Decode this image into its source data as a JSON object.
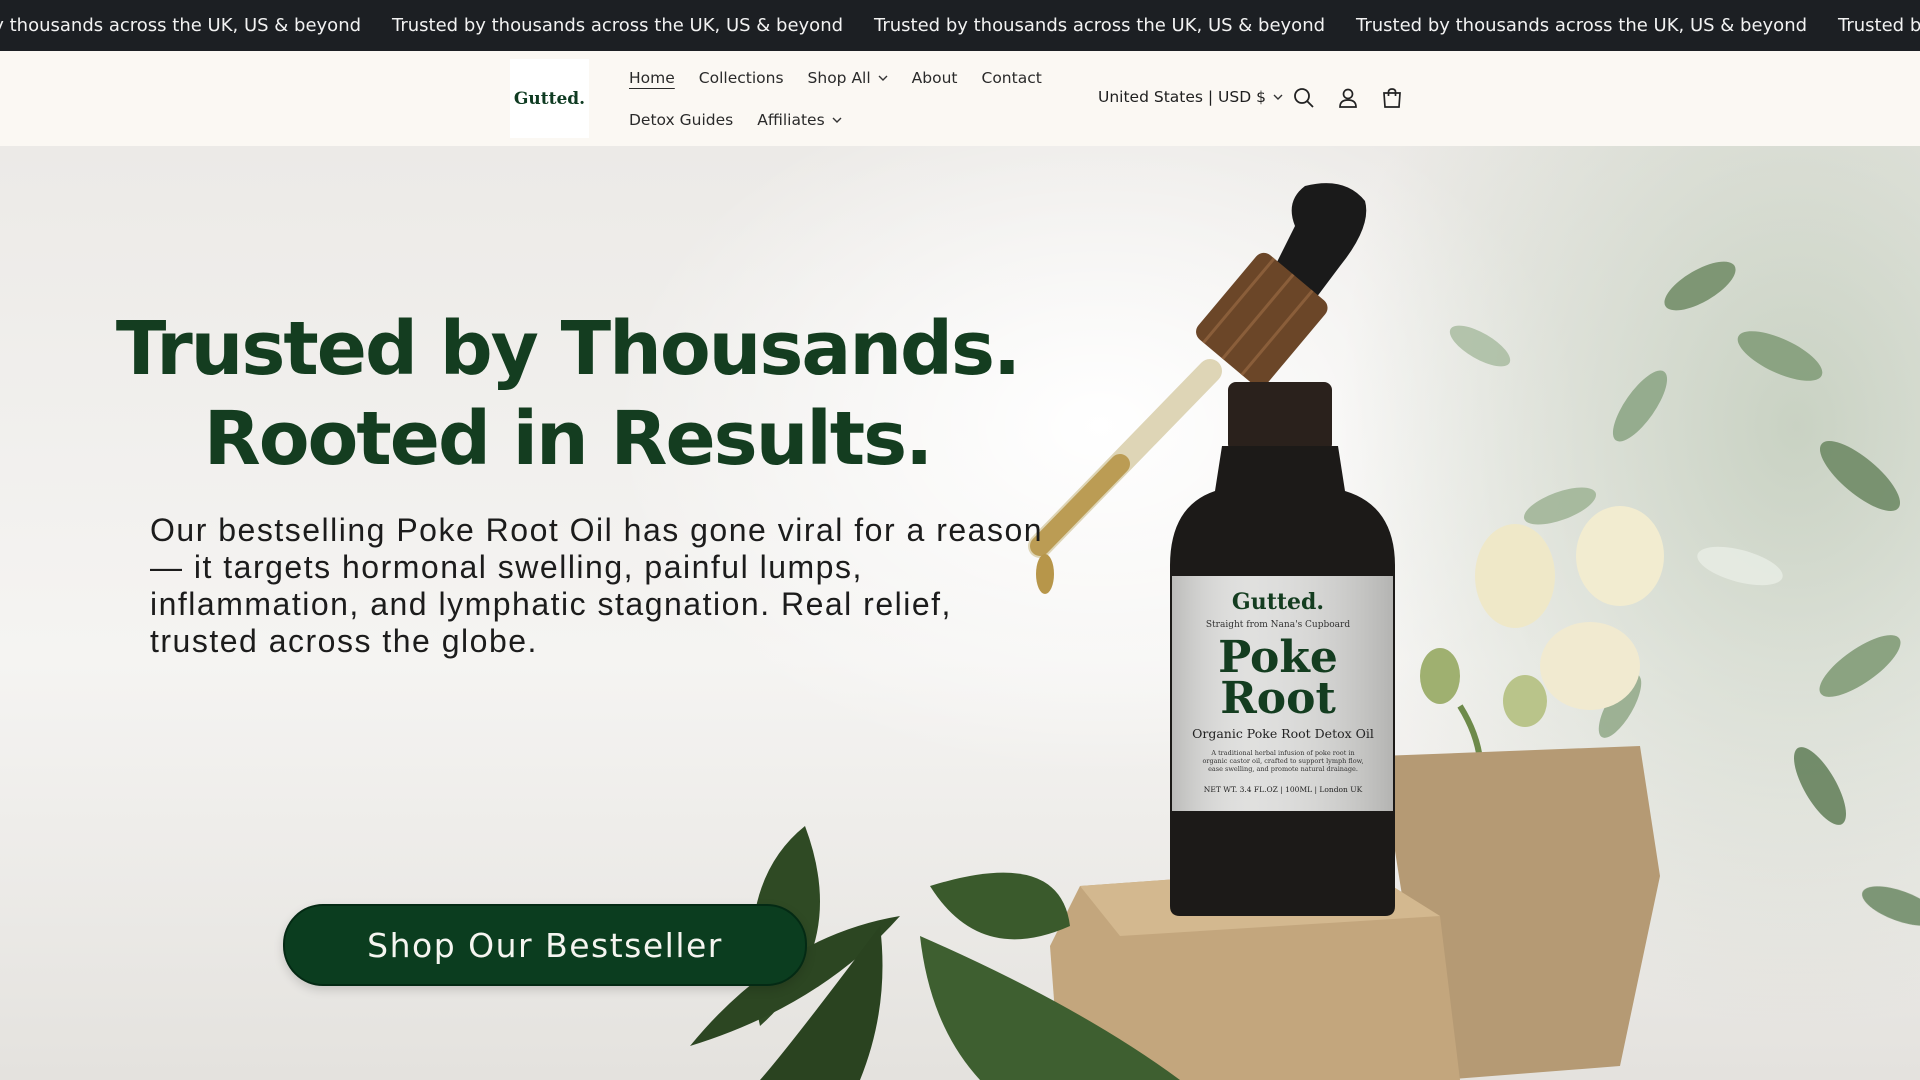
{
  "announcement": {
    "items": [
      "Trusted by thousands across the UK, US & beyond",
      "Trusted by thousands across the UK, US & beyond",
      "Trusted by thousands across the UK, US & beyond",
      "Trusted by thousands across the UK, US & beyond",
      "Trusted by thousands across the UK, US & beyond"
    ]
  },
  "header": {
    "logo_text": "Gutted.",
    "nav": [
      {
        "label": "Home",
        "active": true
      },
      {
        "label": "Collections"
      },
      {
        "label": "Shop All",
        "dropdown": true
      },
      {
        "label": "About"
      },
      {
        "label": "Contact"
      },
      {
        "label": "Detox Guides"
      },
      {
        "label": "Affiliates",
        "dropdown": true
      }
    ],
    "locale": "United States | USD $",
    "icons": [
      "search-icon",
      "account-icon",
      "cart-icon"
    ]
  },
  "hero": {
    "headline_line1": "Trusted by Thousands.",
    "headline_line2": "Rooted in Results.",
    "description": "Our bestselling Poke Root Oil has gone viral for a reason — it targets hormonal swelling, painful lumps, inflammation, and lymphatic stagnation. Real relief, trusted across the globe.",
    "cta_label": "Shop Our Bestseller",
    "product_label": {
      "brand": "Gutted.",
      "tagline": "Straight from Nana's Cupboard",
      "name_line1": "Poke",
      "name_line2": "Root",
      "subtitle": "Organic Poke Root Detox Oil",
      "blurb_lines": [
        "A traditional herbal infusion of poke root in",
        "organic castor oil, crafted to support lymph flow,",
        "ease swelling, and promote natural drainage."
      ],
      "net_wt": "NET WT. 3.4 FL.OZ | 100ML | London UK"
    }
  },
  "colors": {
    "brand_green": "#0b3d1f",
    "headline_green": "#143d20",
    "announcement_bg": "#1c1f23",
    "header_bg": "#fbf8f3"
  }
}
